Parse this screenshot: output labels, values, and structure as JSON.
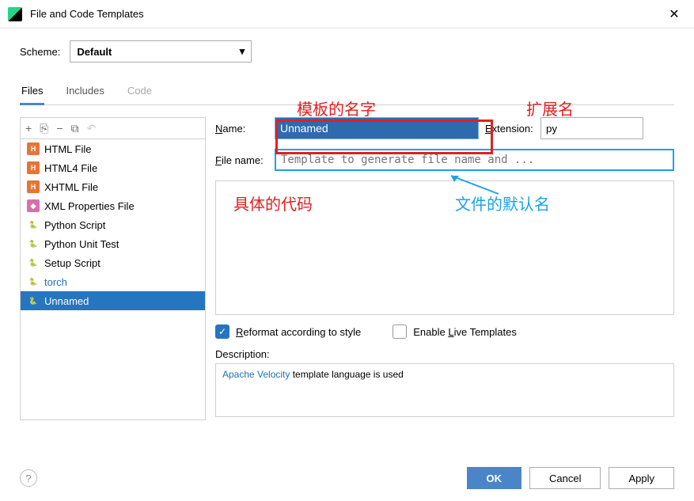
{
  "window": {
    "title": "File and Code Templates"
  },
  "scheme": {
    "label": "Scheme:",
    "value": "Default"
  },
  "tabs": {
    "files": "Files",
    "includes": "Includes",
    "code": "Code"
  },
  "list": {
    "items": [
      {
        "label": "HTML File",
        "icon": "H"
      },
      {
        "label": "HTML4 File",
        "icon": "H"
      },
      {
        "label": "XHTML File",
        "icon": "H"
      },
      {
        "label": "XML Properties File",
        "icon": "xml"
      },
      {
        "label": "Python Script",
        "icon": "py"
      },
      {
        "label": "Python Unit Test",
        "icon": "py"
      },
      {
        "label": "Setup Script",
        "icon": "py"
      },
      {
        "label": "torch",
        "icon": "py",
        "blue": true
      },
      {
        "label": "Unnamed",
        "icon": "py",
        "selected": true
      }
    ]
  },
  "form": {
    "name_label": "Name:",
    "name_value": "Unnamed",
    "ext_label": "Extension:",
    "ext_value": "py",
    "file_label": "File name:",
    "file_placeholder": "Template to generate file name and ..."
  },
  "checks": {
    "reformat": "Reformat according to style",
    "live": "Enable Live Templates"
  },
  "desc": {
    "label": "Description:",
    "link": "Apache Velocity",
    "text": " template language is used"
  },
  "buttons": {
    "ok": "OK",
    "cancel": "Cancel",
    "apply": "Apply"
  },
  "annotations": {
    "a1": "模板的名字",
    "a2": "扩展名",
    "a3": "具体的代码",
    "a4": "文件的默认名"
  }
}
